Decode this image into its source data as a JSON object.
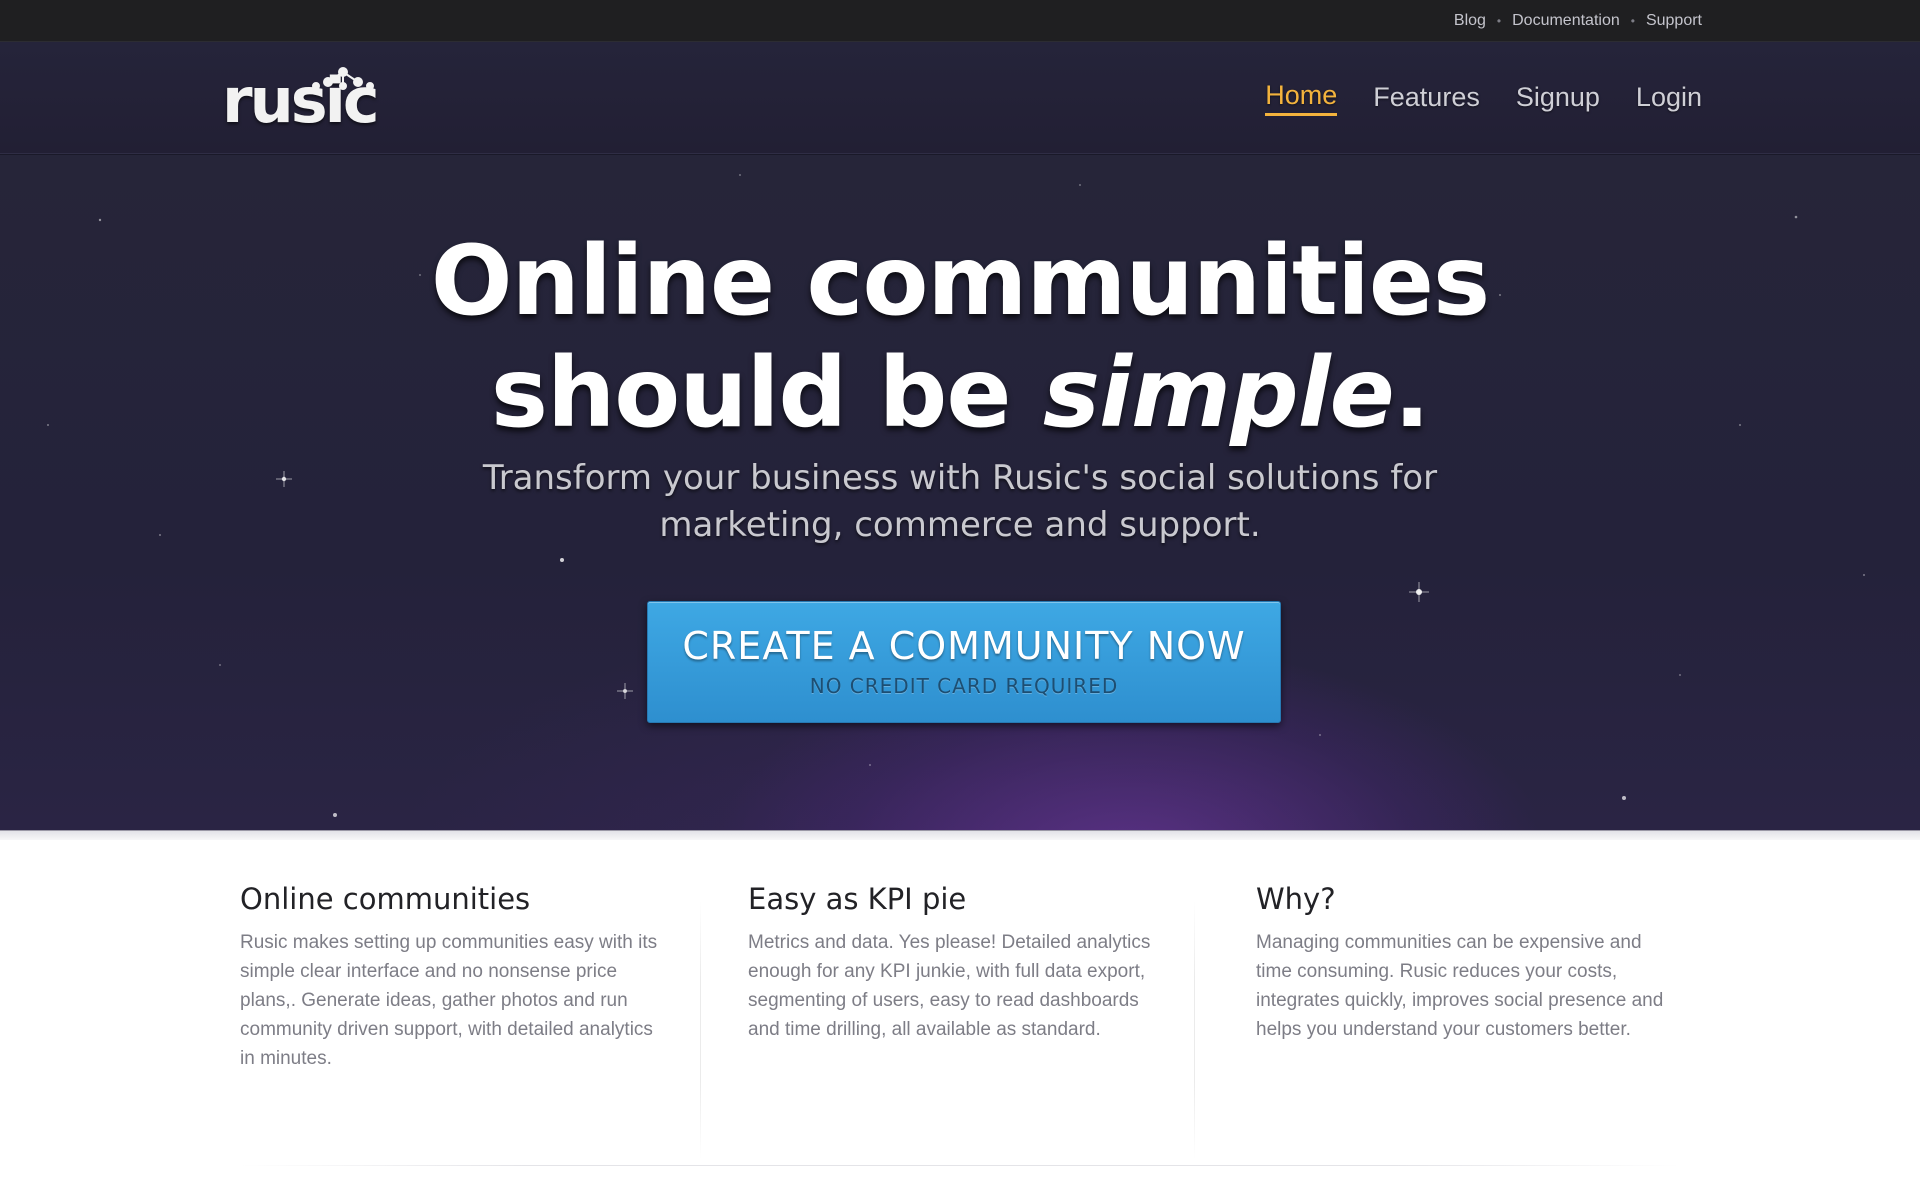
{
  "utility_nav": {
    "items": [
      {
        "label": "Blog"
      },
      {
        "label": "Documentation"
      },
      {
        "label": "Support"
      }
    ],
    "separator": "•"
  },
  "header": {
    "logo_text": "rusic",
    "nav": [
      {
        "label": "Home",
        "active": true
      },
      {
        "label": "Features",
        "active": false
      },
      {
        "label": "Signup",
        "active": false
      },
      {
        "label": "Login",
        "active": false
      }
    ]
  },
  "hero": {
    "title_line1": "Online communities",
    "title_line2_prefix": "should be ",
    "title_line2_emphasis": "simple",
    "title_line2_suffix": ".",
    "subtitle": "Transform your business with Rusic's social solutions for marketing, commerce and support.",
    "cta_label": "CREATE A COMMUNITY NOW",
    "cta_sublabel": "NO CREDIT CARD REQUIRED"
  },
  "features": [
    {
      "heading": "Online communities",
      "body": "Rusic makes setting up communities easy with its simple clear interface and no nonsense price plans,. Generate ideas, gather photos and run community driven support, with detailed analytics in minutes."
    },
    {
      "heading": "Easy as KPI pie",
      "body": "Metrics and data. Yes please! Detailed analytics enough for any KPI junkie, with full data export, segmenting of users, easy to read dashboards and time drilling, all available as standard."
    },
    {
      "heading": "Why?",
      "body": "Managing communities can be expensive and time consuming. Rusic reduces your costs, integrates quickly, improves social presence and helps you understand your customers better."
    }
  ],
  "colors": {
    "accent_active_nav": "#f3b33d",
    "cta_blue": "#3ea8e4",
    "hero_background": "#262539"
  }
}
